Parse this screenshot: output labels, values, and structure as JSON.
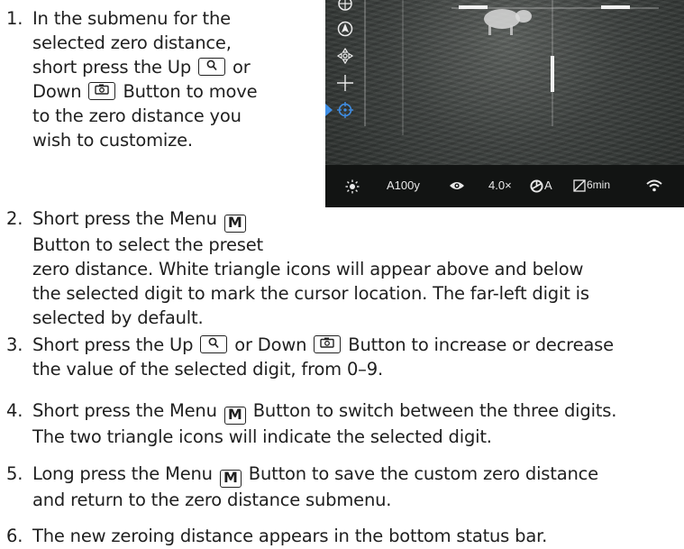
{
  "steps": [
    {
      "number": "1.",
      "lines": [
        "In the submenu for the",
        "selected zero distance,",
        "short press the Up [UP] or",
        "Down [DOWN] Button to move",
        "to the zero distance you",
        "wish to customize."
      ]
    },
    {
      "number": "2.",
      "lines": [
        "Short press the Menu [M]",
        "Button to select the preset",
        "zero distance. White triangle icons will appear above and below",
        "the selected digit to mark the cursor location. The far-left digit is",
        "selected by default."
      ]
    },
    {
      "number": "3.",
      "lines": [
        "Short press the Up [UP] or Down [DOWN] Button to increase or decrease",
        "the value of the selected digit, from 0–9."
      ]
    },
    {
      "number": "4.",
      "lines": [
        "Short press the Menu [M] Button to switch between the three digits.",
        "The two triangle icons will indicate the selected digit."
      ]
    },
    {
      "number": "5.",
      "lines": [
        "Long press the Menu [M] Button to save the custom zero distance",
        "and return to the zero distance submenu."
      ]
    },
    {
      "number": "6.",
      "lines": [
        "The new zeroing distance appears in the bottom status bar."
      ]
    }
  ],
  "keys": {
    "menu_label": "M"
  },
  "device_screen": {
    "side_menu_icons": [
      "reticle-circle-icon",
      "compass-arrow-icon",
      "crosshair-move-icon",
      "crosshair-plus-icon",
      "zero-target-icon"
    ],
    "selected_side_icon": "zero-target-icon",
    "status_bar": {
      "brightness_icon": "brightness-sun-icon",
      "zero_distance": "A100y",
      "view_mode_icon": "eye-icon",
      "zoom": "4.0×",
      "palette_icon": "palette-wheel-icon",
      "palette_mode": "A",
      "standby_icon": "auto-standby-icon",
      "standby_time": "6min",
      "wifi_icon": "wifi-icon"
    }
  },
  "colors": {
    "selection_accent": "#3f8fe6",
    "text": "#1f1f1f",
    "screen_bg": "#3c403e"
  }
}
